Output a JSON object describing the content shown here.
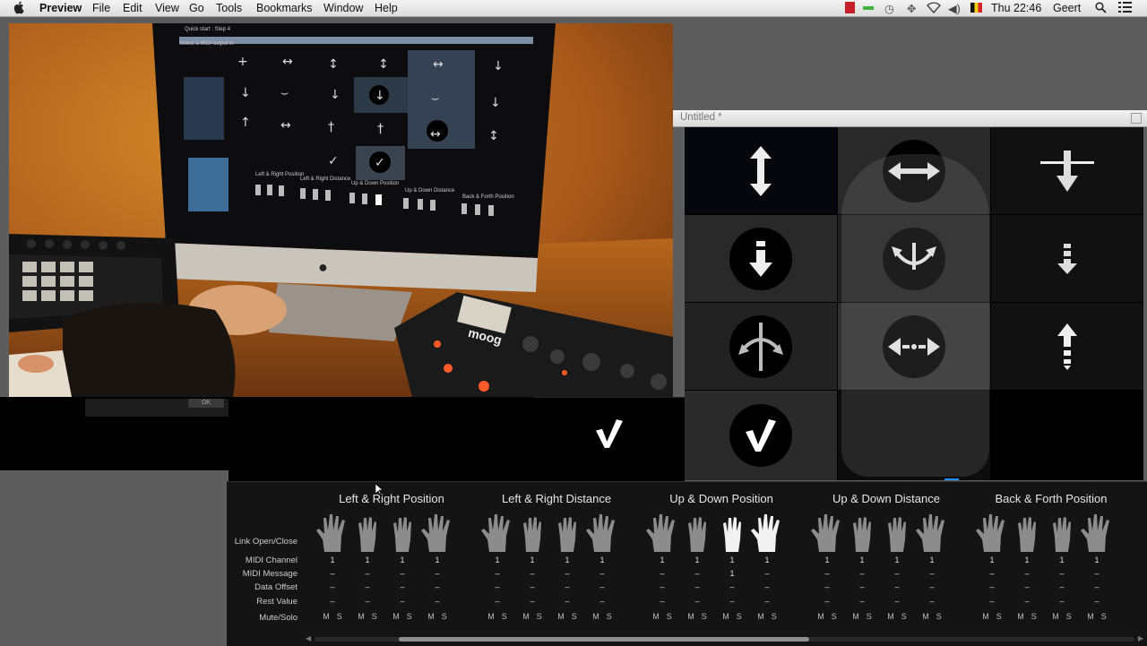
{
  "menubar": {
    "app": "Preview",
    "items": [
      "File",
      "Edit",
      "View",
      "Go",
      "Tools",
      "Bookmarks",
      "Window",
      "Help"
    ],
    "clock": "Thu 22:46",
    "user": "Geert"
  },
  "video": {
    "screen_header": "Quick start : Step 4",
    "screen_sub": "Select a MIDI output in",
    "ok": "OK",
    "synth_brand": "moog",
    "screen_groups": [
      "Left & Right Position",
      "Left & Right Distance",
      "Up & Down Position",
      "Up & Down Distance",
      "Back & Forth Position"
    ]
  },
  "untitled": {
    "title": "Untitled *",
    "icons": [
      [
        "↕",
        "↔",
        "⊤"
      ],
      [
        "↕",
        "⌣",
        "↕"
      ],
      [
        "⟷",
        "↔",
        "↕"
      ],
      [
        "✓",
        "",
        ""
      ]
    ],
    "left_check": "✓"
  },
  "panel": {
    "row_labels": [
      "Link Open/Close",
      "MIDI Channel",
      "MIDI Message",
      "Data Offset",
      "Rest Value",
      "Mute/Solo"
    ],
    "groups": [
      {
        "title": "Left & Right Position",
        "channel": [
          "1",
          "1",
          "1",
          "1"
        ],
        "message": [
          "–",
          "–",
          "–",
          "–"
        ],
        "offset": [
          "–",
          "–",
          "–",
          "–"
        ],
        "rest": [
          "–",
          "–",
          "–",
          "–"
        ],
        "active": [
          false,
          false,
          false,
          false
        ]
      },
      {
        "title": "Left & Right Distance",
        "channel": [
          "1",
          "1",
          "1",
          "1"
        ],
        "message": [
          "–",
          "–",
          "–",
          "–"
        ],
        "offset": [
          "–",
          "–",
          "–",
          "–"
        ],
        "rest": [
          "–",
          "–",
          "–",
          "–"
        ],
        "active": [
          false,
          false,
          false,
          false
        ]
      },
      {
        "title": "Up & Down Position",
        "channel": [
          "1",
          "1",
          "1",
          "1"
        ],
        "message": [
          "–",
          "–",
          "1",
          "–"
        ],
        "offset": [
          "–",
          "–",
          "–",
          "–"
        ],
        "rest": [
          "–",
          "–",
          "–",
          "–"
        ],
        "active": [
          false,
          false,
          true,
          true
        ]
      },
      {
        "title": "Up & Down Distance",
        "channel": [
          "1",
          "1",
          "1",
          "1"
        ],
        "message": [
          "–",
          "–",
          "–",
          "–"
        ],
        "offset": [
          "–",
          "–",
          "–",
          "–"
        ],
        "rest": [
          "–",
          "–",
          "–",
          "–"
        ],
        "active": [
          false,
          false,
          false,
          false
        ]
      },
      {
        "title": "Back & Forth Position",
        "channel": [
          "1",
          "1",
          "1",
          "1"
        ],
        "message": [
          "–",
          "–",
          "–",
          "–"
        ],
        "offset": [
          "–",
          "–",
          "–",
          "–"
        ],
        "rest": [
          "–",
          "–",
          "–",
          "–"
        ],
        "active": [
          false,
          false,
          false,
          false
        ]
      }
    ],
    "mute": "M",
    "solo": "S",
    "scroll_left": "◀",
    "scroll_right": "▶"
  },
  "colors": {
    "accent": "#1f8fff",
    "panel": "#141414",
    "photo_warm": "#a35a16"
  }
}
